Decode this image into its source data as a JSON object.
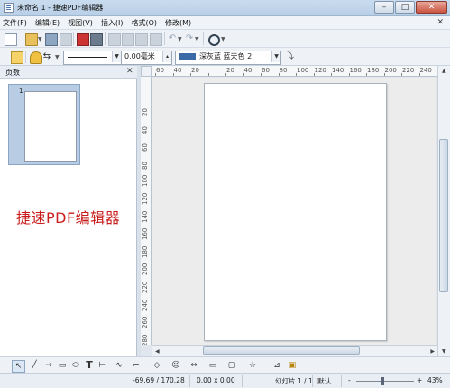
{
  "window": {
    "title": "未命名 1 - 捷速PDF编辑器",
    "minimize": "–",
    "maximize": "□",
    "close": "✕"
  },
  "menu": {
    "items": [
      "文件(F)",
      "编辑(E)",
      "视图(V)",
      "插入(I)",
      "格式(O)",
      "修改(M)"
    ],
    "close_doc": "✕"
  },
  "toolbar2": {
    "line_width": "0.00毫米",
    "fill_color_label": "深灰蓝 蓝天色 2",
    "fill_color": "#3b6aa6"
  },
  "pages_pane": {
    "title": "页数",
    "close": "✕",
    "thumbnail_number": "1"
  },
  "watermark": "捷速PDF编辑器",
  "hruler": {
    "labels": [
      "60",
      "40",
      "20",
      "",
      "20",
      "40",
      "60",
      "80",
      "100",
      "120",
      "140",
      "160",
      "180",
      "200",
      "220",
      "240"
    ]
  },
  "vruler": {
    "labels": [
      "20",
      "40",
      "60",
      "80",
      "100",
      "120",
      "140",
      "160",
      "180",
      "200",
      "220",
      "240",
      "260",
      "280"
    ]
  },
  "status": {
    "position": "-69.69 / 170.28",
    "size": "0.00 x 0.00",
    "page": "幻灯片 1 / 1",
    "layout": "默认",
    "zoom_minus": "-",
    "zoom_plus": "+",
    "zoom": "43%"
  },
  "drawbar": {
    "text_tool": "T"
  }
}
